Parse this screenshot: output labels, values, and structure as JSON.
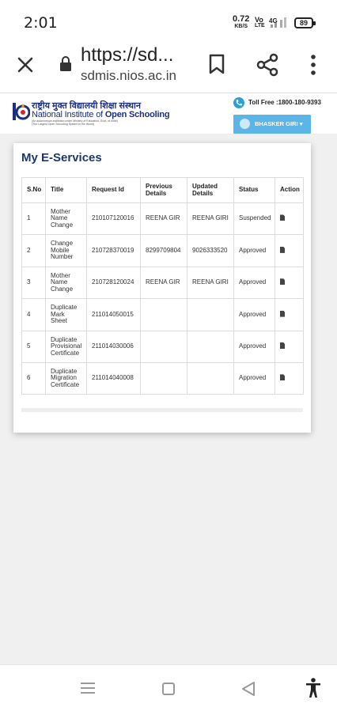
{
  "status_bar": {
    "time": "2:01",
    "net_speed": "0.72",
    "net_unit": "KB/S",
    "volte_top": "Vo",
    "volte_bottom": "LTE",
    "network": "4G",
    "battery": "89"
  },
  "browser": {
    "url_main": "https://sd...",
    "url_sub": "sdmis.nios.ac.in"
  },
  "site_header": {
    "hindi_name": "राष्ट्रीय मुक्त विद्यालयी शिक्षा संस्थान",
    "english_prefix": "National Institute of ",
    "english_bold": "Open Schooling",
    "tagline_1": "(An autonomous institution under Ministry of Education, Govt. of India)",
    "tagline_2": "(The Largest Open Schooling System in the World)",
    "toll_free": "Toll Free :1800-180-9393",
    "user_name": "BHASKER GIRI"
  },
  "card": {
    "title": "My E-Services"
  },
  "table": {
    "headers": {
      "sno": "S.No",
      "title": "Title",
      "request_id": "Request Id",
      "previous": "Previous Details",
      "updated": "Updated Details",
      "status": "Status",
      "action": "Action"
    },
    "rows": [
      {
        "sno": "1",
        "title": "Mother Name Change",
        "request_id": "210107120016",
        "previous": "REENA GIR",
        "updated": "REENA GIRI",
        "status": "Suspended"
      },
      {
        "sno": "2",
        "title": "Change Mobile Number",
        "request_id": "210728370019",
        "previous": "8299709804",
        "updated": "9026333520",
        "status": "Approved"
      },
      {
        "sno": "3",
        "title": "Mother Name Change",
        "request_id": "210728120024",
        "previous": "REENA GIR",
        "updated": "REENA GIRI",
        "status": "Approved"
      },
      {
        "sno": "4",
        "title": "Duplicate Mark Sheet",
        "request_id": "211014050015",
        "previous": "",
        "updated": "",
        "status": "Approved"
      },
      {
        "sno": "5",
        "title": "Duplicate Provisional Certificate",
        "request_id": "211014030006",
        "previous": "",
        "updated": "",
        "status": "Approved"
      },
      {
        "sno": "6",
        "title": "Duplicate Migration Certificate",
        "request_id": "211014040008",
        "previous": "",
        "updated": "",
        "status": "Approved"
      }
    ]
  },
  "icons": {
    "close": "close-icon",
    "lock": "lock-icon",
    "bookmark": "bookmark-icon",
    "share": "share-icon",
    "more": "more-vertical-icon",
    "phone": "phone-icon",
    "user": "user-icon",
    "document": "document-icon",
    "nav_menu": "recent-apps-icon",
    "nav_home": "home-icon",
    "nav_back": "back-icon",
    "accessibility": "accessibility-icon"
  }
}
